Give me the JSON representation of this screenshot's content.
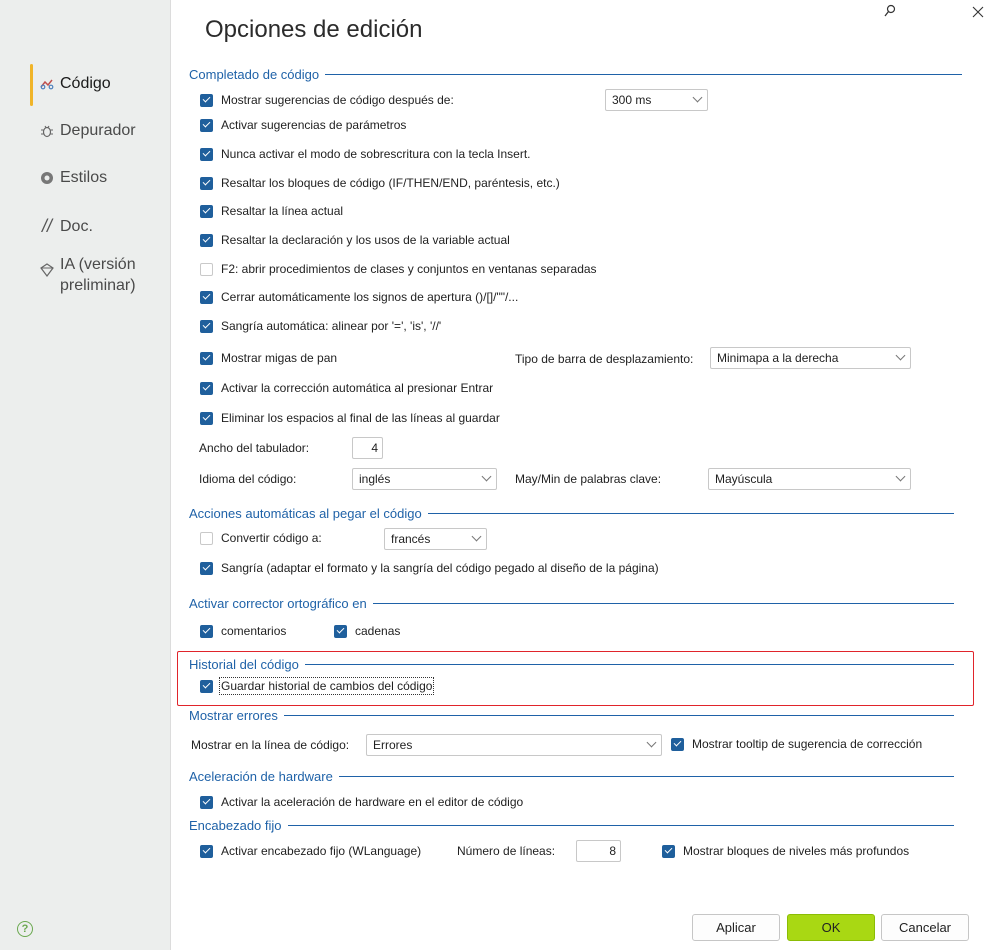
{
  "window": {
    "title": "Opciones de edición",
    "search_icon": "search-icon",
    "close_icon": "close-icon"
  },
  "sidebar": {
    "items": [
      {
        "label": "Código",
        "icon": "code-icon",
        "active": true
      },
      {
        "label": "Depurador",
        "icon": "bug-icon"
      },
      {
        "label": "Estilos",
        "icon": "style-icon"
      },
      {
        "label": "Doc.",
        "icon": "doc-icon"
      },
      {
        "label": "IA (versión",
        "label2": "preliminar)",
        "icon": "ai-icon"
      }
    ],
    "help_label": "?"
  },
  "completado": {
    "title": "Completado de código",
    "opt1": "Mostrar sugerencias de código después de:",
    "opt1_value": "300 ms",
    "opt2": "Activar sugerencias de parámetros",
    "opt3": "Nunca activar el modo de sobrescritura con la tecla Insert.",
    "opt4": "Resaltar los bloques de código (IF/THEN/END, paréntesis, etc.)",
    "opt5": "Resaltar la línea actual",
    "opt6": "Resaltar la declaración y los usos de la variable actual",
    "opt7": "F2: abrir procedimientos de clases y conjuntos en ventanas separadas",
    "opt8": "Cerrar automáticamente los signos de apertura ()/[]/\"\"/...",
    "opt9": "Sangría automática: alinear por '=', 'is', '//'",
    "opt10": "Mostrar migas de pan",
    "scrollbar_label": "Tipo de barra de desplazamiento:",
    "scrollbar_value": "Minimapa a la derecha",
    "opt11": "Activar la corrección automática al presionar Entrar",
    "opt12": "Eliminar los espacios al final de las líneas al guardar",
    "tab_label": "Ancho del tabulador:",
    "tab_value": "4",
    "lang_label": "Idioma del código:",
    "lang_value": "inglés",
    "case_label": "May/Min de palabras clave:",
    "case_value": "Mayúscula"
  },
  "pegar": {
    "title": "Acciones automáticas al pegar el código",
    "convert_label": "Convertir código a:",
    "convert_value": "francés",
    "indent_label": "Sangría (adaptar el formato y la sangría del código pegado al diseño de la página)"
  },
  "corrector": {
    "title": "Activar corrector ortográfico en",
    "comments": "comentarios",
    "strings": "cadenas"
  },
  "historial": {
    "title": "Historial del código",
    "save_label": "Guardar historial de cambios del código"
  },
  "errores": {
    "title": "Mostrar errores",
    "line_label": "Mostrar en la línea de código:",
    "line_value": "Errores",
    "tooltip_label": "Mostrar tooltip de sugerencia de corrección"
  },
  "hardware": {
    "title": "Aceleración de hardware",
    "label": "Activar la aceleración de hardware en el editor de código"
  },
  "encabezado": {
    "title": "Encabezado fijo",
    "label": "Activar encabezado fijo (WLanguage)",
    "lines_label": "Número de líneas:",
    "lines_value": "8",
    "deep_label": "Mostrar bloques de niveles más profundos"
  },
  "buttons": {
    "apply": "Aplicar",
    "ok": "OK",
    "cancel": "Cancelar"
  },
  "colors": {
    "accent": "#1f62a8",
    "checkbox": "#1f5f9c",
    "highlight": "#e0242b",
    "ok_button": "#a9d813",
    "sidebar_bg": "#eceeed"
  }
}
